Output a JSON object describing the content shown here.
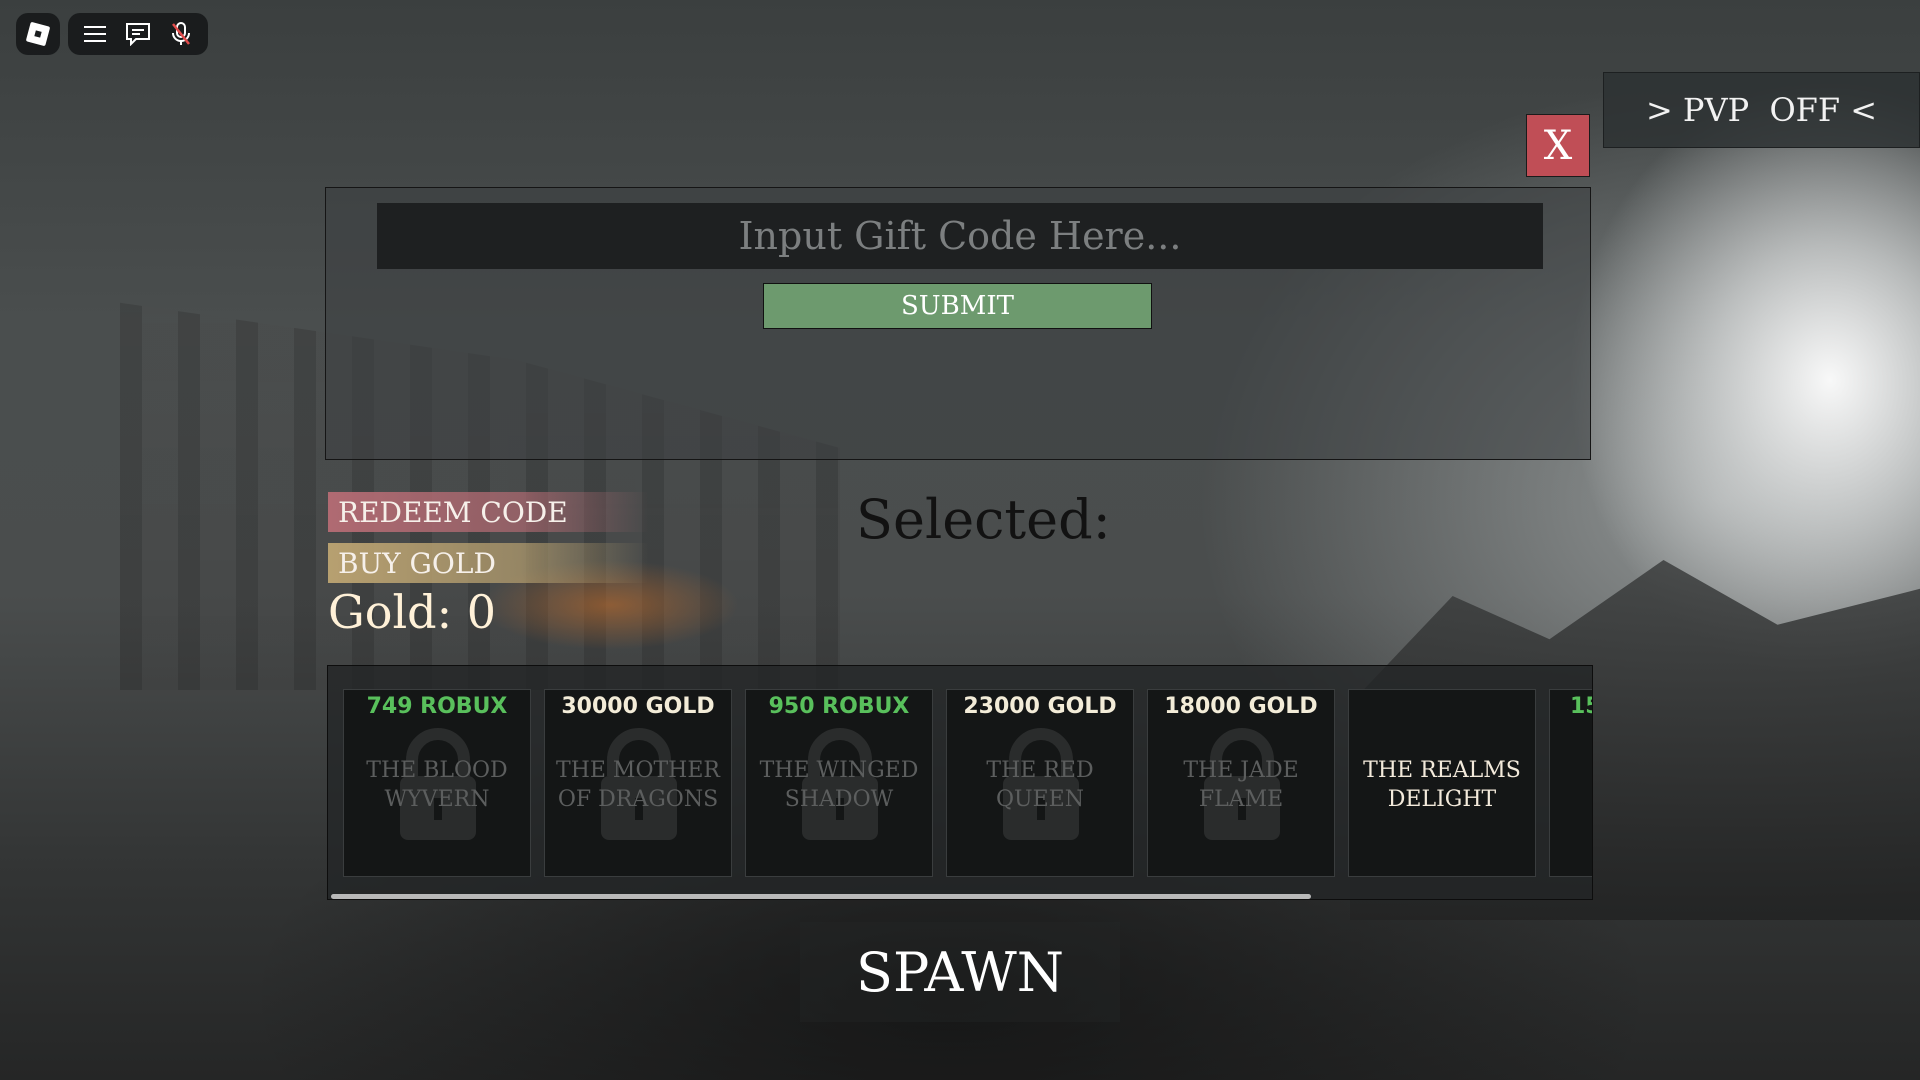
{
  "topbar": {
    "menu_icon": "hamburger-menu-icon",
    "chat_icon": "chat-icon",
    "mic_icon": "microphone-muted-icon"
  },
  "pvp_toggle": {
    "label": "> PVP  OFF <"
  },
  "close_button": {
    "label": "X",
    "color": "#c04e56"
  },
  "gift_code": {
    "placeholder": "Input Gift Code Here...",
    "value": "",
    "submit_label": "SUBMIT",
    "submit_color": "#6d9a6e"
  },
  "menu": {
    "redeem_label": "REDEEM CODE",
    "buy_gold_label": "BUY GOLD",
    "gold_text": "Gold: 0"
  },
  "selected_label": "Selected:",
  "dragons": [
    {
      "price": "749 ROBUX",
      "currency": "robux",
      "name": "THE BLOOD WYVERN",
      "locked": true
    },
    {
      "price": "30000 GOLD",
      "currency": "gold",
      "name": "THE MOTHER OF DRAGONS",
      "locked": true
    },
    {
      "price": "950 ROBUX",
      "currency": "robux",
      "name": "THE WINGED SHADOW",
      "locked": true
    },
    {
      "price": "23000 GOLD",
      "currency": "gold",
      "name": "THE RED QUEEN",
      "locked": true
    },
    {
      "price": "18000 GOLD",
      "currency": "gold",
      "name": "THE JADE FLAME",
      "locked": true
    },
    {
      "price": "",
      "currency": "",
      "name": "THE REALMS DELIGHT",
      "locked": false
    },
    {
      "price": "15",
      "currency": "robux",
      "name": "",
      "locked": true
    }
  ],
  "spawn_button": {
    "label": "SPAWN"
  },
  "colors": {
    "robux_price": "#59c05c",
    "gold_price": "#f3ecd8"
  }
}
